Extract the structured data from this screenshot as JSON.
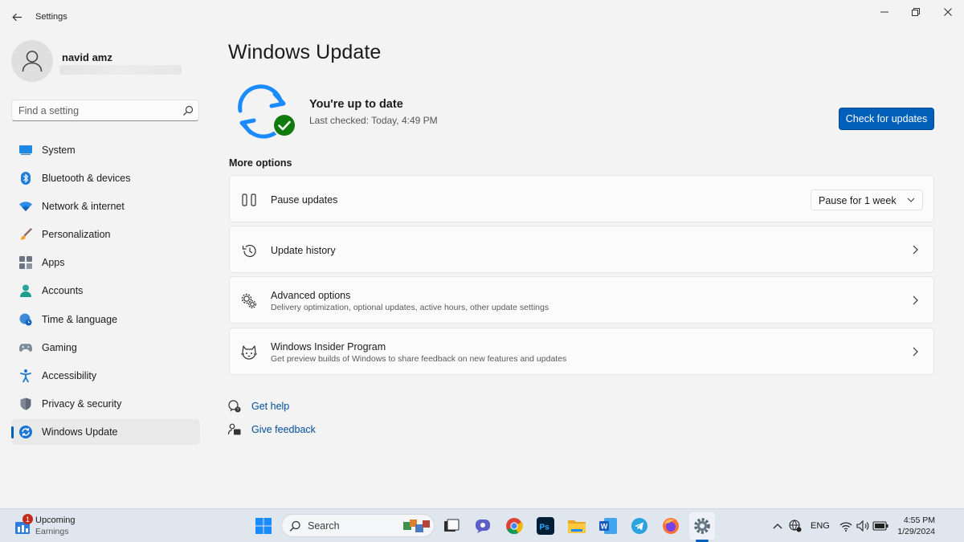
{
  "window": {
    "title": "Settings"
  },
  "profile": {
    "name": "navid amz"
  },
  "search": {
    "placeholder": "Find a setting"
  },
  "sidebar": {
    "items": [
      {
        "label": "System",
        "icon": "system-icon"
      },
      {
        "label": "Bluetooth & devices",
        "icon": "bluetooth-icon"
      },
      {
        "label": "Network & internet",
        "icon": "wifi-icon"
      },
      {
        "label": "Personalization",
        "icon": "brush-icon"
      },
      {
        "label": "Apps",
        "icon": "apps-icon"
      },
      {
        "label": "Accounts",
        "icon": "accounts-icon"
      },
      {
        "label": "Time & language",
        "icon": "globe-clock-icon"
      },
      {
        "label": "Gaming",
        "icon": "gamepad-icon"
      },
      {
        "label": "Accessibility",
        "icon": "accessibility-icon"
      },
      {
        "label": "Privacy & security",
        "icon": "shield-icon"
      },
      {
        "label": "Windows Update",
        "icon": "windows-update-icon",
        "active": true
      }
    ]
  },
  "main": {
    "title": "Windows Update",
    "status_title": "You're up to date",
    "status_sub": "Last checked: Today, 4:49 PM",
    "check_button": "Check for updates",
    "more_options": "More options",
    "options": [
      {
        "title": "Pause updates",
        "icon": "pause-icon",
        "control": "Pause for 1 week"
      },
      {
        "title": "Update history",
        "icon": "history-icon"
      },
      {
        "title": "Advanced options",
        "subtitle": "Delivery optimization, optional updates, active hours, other update settings",
        "icon": "gears-icon"
      },
      {
        "title": "Windows Insider Program",
        "subtitle": "Get preview builds of Windows to share feedback on new features and updates",
        "icon": "insider-cat-icon"
      }
    ],
    "links": {
      "help": "Get help",
      "feedback": "Give feedback"
    }
  },
  "taskbar": {
    "widget_badge": "1",
    "widget_title": "Upcoming",
    "widget_sub": "Earnings",
    "search_label": "Search",
    "apps": [
      "start-icon",
      "task-view-icon",
      "chat-icon",
      "chrome-icon",
      "photoshop-icon",
      "file-explorer-icon",
      "word-icon",
      "telegram-icon",
      "firefox-icon",
      "settings-icon"
    ],
    "language": "ENG",
    "time": "4:55 PM",
    "date": "1/29/2024"
  },
  "colors": {
    "accent": "#005fb8",
    "link": "#004e9a",
    "success": "#0f7b0f",
    "badge": "#c42b1c"
  }
}
